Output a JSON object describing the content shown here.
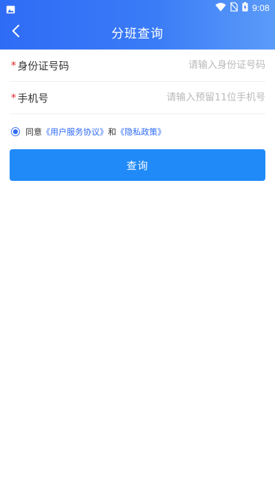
{
  "status_bar": {
    "time": "9:08",
    "icons": [
      "image-icon",
      "wifi-icon",
      "sim-off-icon",
      "battery-charging-icon"
    ]
  },
  "header": {
    "title": "分班查询",
    "back_icon": "chevron-left-icon"
  },
  "form": {
    "id_card": {
      "required_mark": "*",
      "label": "身份证号码",
      "placeholder": "请输入身份证号码",
      "value": ""
    },
    "phone": {
      "required_mark": "*",
      "label": "手机号",
      "placeholder": "请输入预留11位手机号",
      "value": ""
    }
  },
  "agreement": {
    "checked": true,
    "prefix": "同意",
    "user_agreement": "《用户服务协议》",
    "and": "和",
    "privacy_policy": "《隐私政策》"
  },
  "submit": {
    "label": "查询"
  },
  "colors": {
    "primary": "#2f6cf6",
    "button": "#1f8af8",
    "required": "#e02b2b",
    "placeholder": "#b9b9b9"
  }
}
